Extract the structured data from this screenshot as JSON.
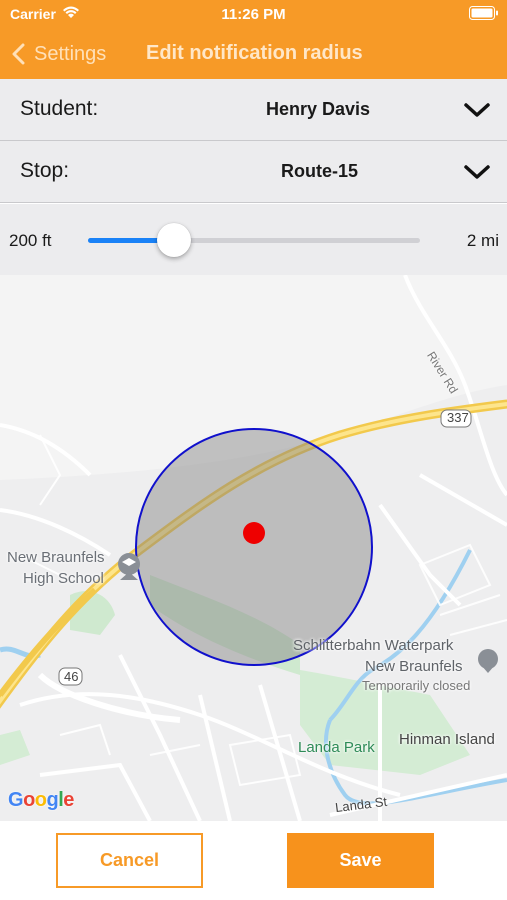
{
  "status_bar": {
    "carrier": "Carrier",
    "time": "11:26 PM"
  },
  "nav": {
    "back_label": "Settings",
    "title": "Edit notification radius"
  },
  "form": {
    "student": {
      "label": "Student:",
      "value": "Henry  Davis"
    },
    "stop": {
      "label": "Stop:",
      "value": "Route-15"
    }
  },
  "radius_slider": {
    "min_label": "200 ft",
    "max_label": "2 mi",
    "value_fraction": 0.26
  },
  "map": {
    "labels": {
      "school_line1": "New Braunfels",
      "school_line2": "High School",
      "waterpark_line1": "Schlitterbahn Waterpark",
      "waterpark_line2": "New Braunfels",
      "waterpark_status": "Temporarily closed",
      "landa_park": "Landa Park",
      "hinman_island": "Hinman Island",
      "landa_st": "Landa St",
      "river_rd": "River Rd",
      "route_337": "337",
      "route_46": "46"
    },
    "attribution": "Google"
  },
  "buttons": {
    "cancel": "Cancel",
    "save": "Save"
  },
  "colors": {
    "header": "#f79a27",
    "slider_fill": "#1a82f7",
    "radius_outline": "#1010cc",
    "stop_marker": "#ee0000"
  }
}
